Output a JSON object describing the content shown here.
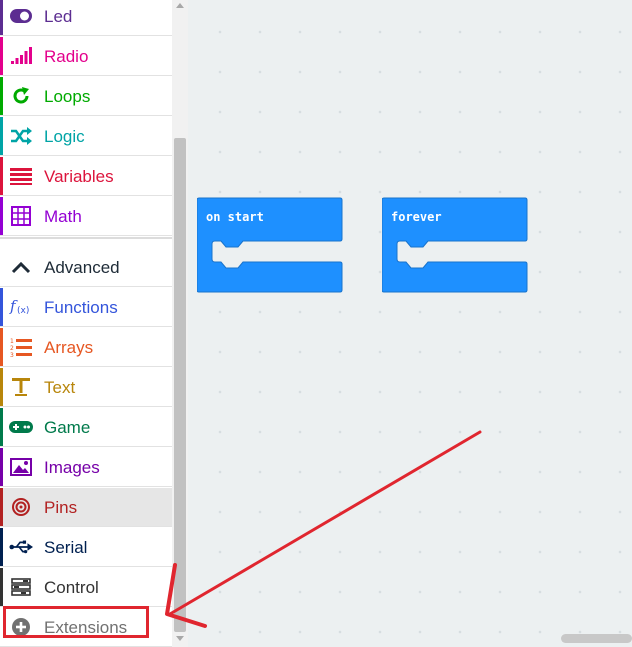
{
  "toolbox": {
    "categories": [
      {
        "id": "led",
        "label": "Led",
        "color": "#5c2d91",
        "icon": "toggle-icon"
      },
      {
        "id": "radio",
        "label": "Radio",
        "color": "#e3008c",
        "icon": "signal-bars-icon"
      },
      {
        "id": "loops",
        "label": "Loops",
        "color": "#00aa00",
        "icon": "loop-arrow-icon"
      },
      {
        "id": "logic",
        "label": "Logic",
        "color": "#00a4a6",
        "icon": "shuffle-icon"
      },
      {
        "id": "variables",
        "label": "Variables",
        "color": "#dc143c",
        "icon": "list-lines-icon"
      },
      {
        "id": "math",
        "label": "Math",
        "color": "#9400d3",
        "icon": "calculator-icon"
      },
      {
        "id": "advanced",
        "label": "Advanced",
        "color": "#1e2b37",
        "icon": "chevron-up-icon"
      },
      {
        "id": "functions",
        "label": "Functions",
        "color": "#3455db",
        "icon": "function-icon"
      },
      {
        "id": "arrays",
        "label": "Arrays",
        "color": "#e65722",
        "icon": "numbered-list-icon"
      },
      {
        "id": "text",
        "label": "Text",
        "color": "#b8860b",
        "icon": "text-t-icon"
      },
      {
        "id": "game",
        "label": "Game",
        "color": "#007a4b",
        "icon": "gamepad-icon"
      },
      {
        "id": "images",
        "label": "Images",
        "color": "#7600a8",
        "icon": "image-icon"
      },
      {
        "id": "pins",
        "label": "Pins",
        "color": "#b22222",
        "icon": "target-icon",
        "selected": true
      },
      {
        "id": "serial",
        "label": "Serial",
        "color": "#002050",
        "icon": "usb-icon"
      },
      {
        "id": "control",
        "label": "Control",
        "color": "#333333",
        "icon": "control-stack-icon"
      },
      {
        "id": "extensions",
        "label": "Extensions",
        "color": "#717171",
        "icon": "plus-circle-icon"
      }
    ]
  },
  "workspace": {
    "blocks": [
      {
        "id": "on-start",
        "label": "on start",
        "color": "#1e90ff"
      },
      {
        "id": "forever",
        "label": "forever",
        "color": "#1e90ff"
      }
    ]
  },
  "annotation": {
    "color": "#e0262f"
  }
}
